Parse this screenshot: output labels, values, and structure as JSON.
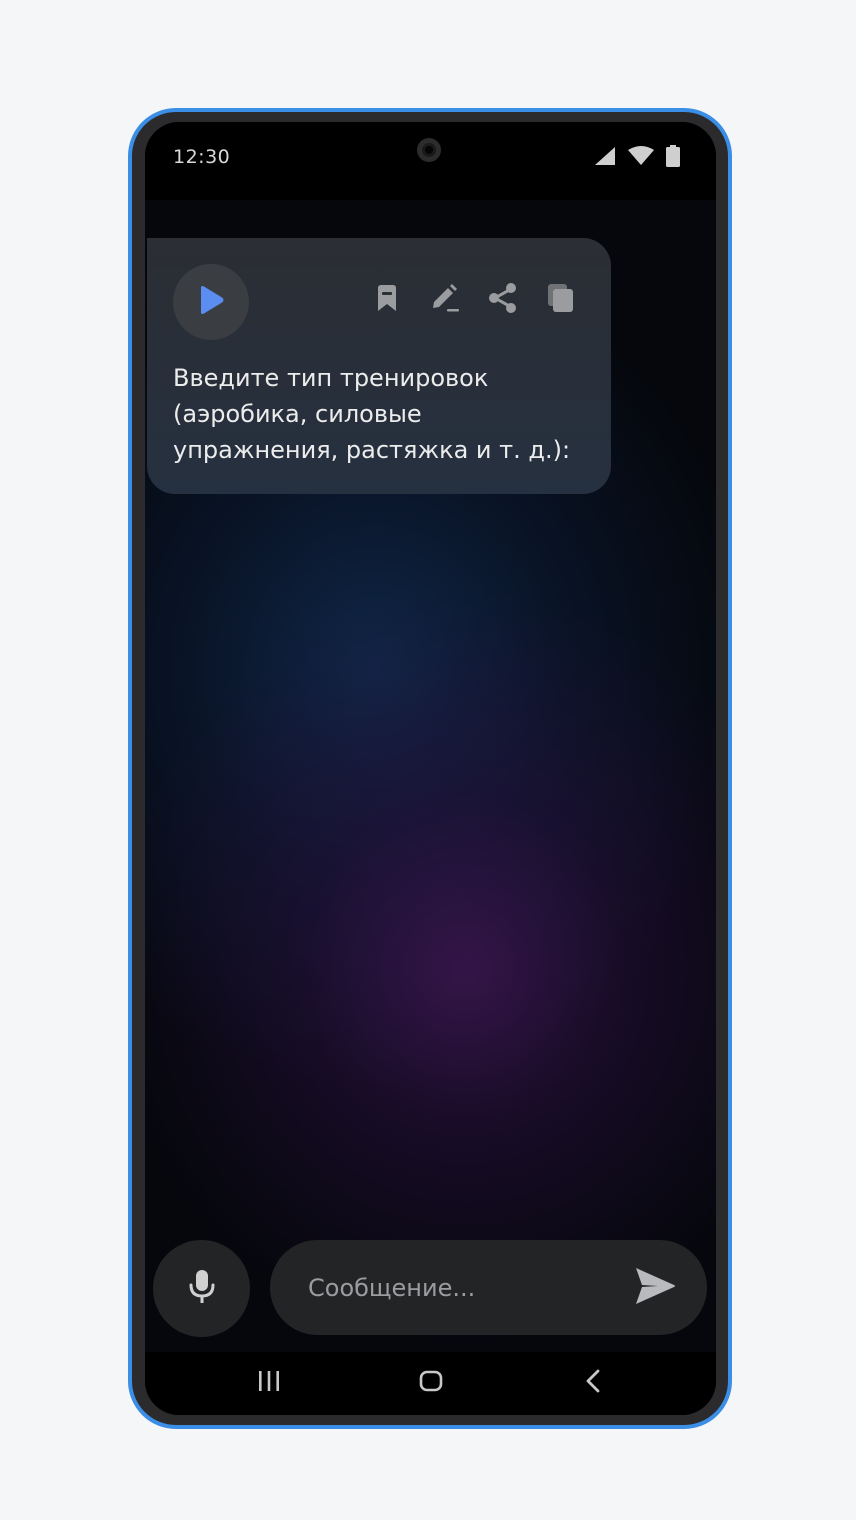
{
  "status_bar": {
    "time": "12:30",
    "icons": [
      "signal-icon",
      "wifi-icon",
      "battery-icon"
    ]
  },
  "message": {
    "lines": [
      "Введите тип тренировок",
      "(аэробика, силовые",
      "упражнения, растяжка и т. д.):"
    ],
    "actions": [
      "bookmark-icon",
      "edit-icon",
      "share-icon",
      "copy-icon"
    ],
    "play_icon": "play-icon"
  },
  "composer": {
    "placeholder": "Сообщение...",
    "mic_icon": "microphone-icon",
    "send_icon": "send-icon"
  },
  "nav": {
    "icons": [
      "recents-icon",
      "home-icon",
      "back-icon"
    ]
  },
  "colors": {
    "frame_accent": "#3a8ee6",
    "play_accent": "#5b8ef0",
    "icon_gray": "#9a9c9f"
  }
}
